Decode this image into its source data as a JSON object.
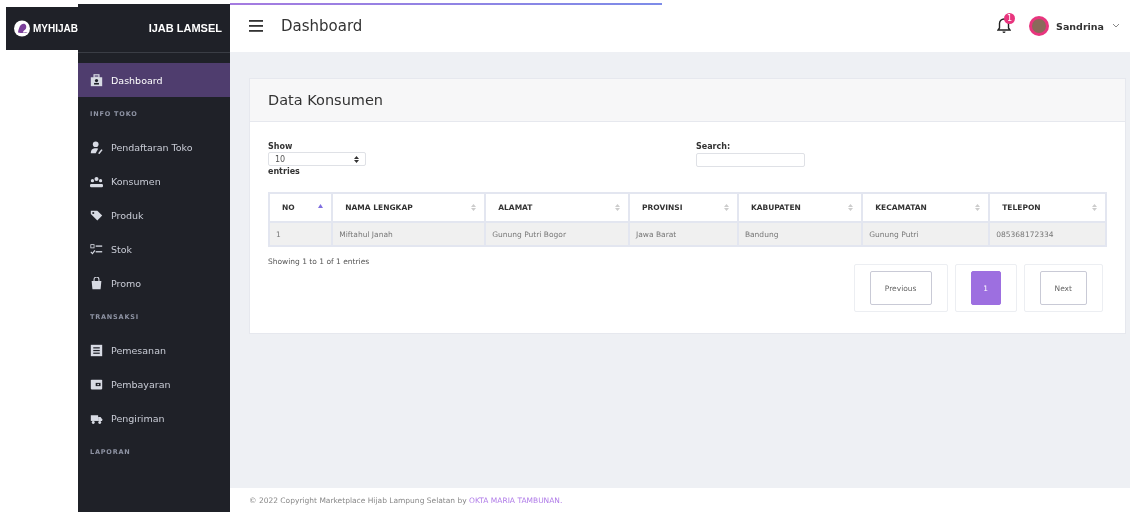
{
  "brand": {
    "logo_text": "MYHIJAB",
    "header_text": "IJAB LAMSEL"
  },
  "sidebar": {
    "items": [
      {
        "kind": "item",
        "label": "Dashboard",
        "selected": true
      },
      {
        "kind": "header",
        "label": "INFO TOKO"
      },
      {
        "kind": "item",
        "label": "Pendaftaran Toko",
        "selected": false
      },
      {
        "kind": "item",
        "label": "Konsumen",
        "selected": false
      },
      {
        "kind": "item",
        "label": "Produk",
        "selected": false
      },
      {
        "kind": "item",
        "label": "Stok",
        "selected": false
      },
      {
        "kind": "item",
        "label": "Promo",
        "selected": false
      },
      {
        "kind": "header",
        "label": "TRANSAKSI"
      },
      {
        "kind": "item",
        "label": "Pemesanan",
        "selected": false
      },
      {
        "kind": "item",
        "label": "Pembayaran",
        "selected": false
      },
      {
        "kind": "item",
        "label": "Pengiriman",
        "selected": false
      },
      {
        "kind": "header",
        "label": "LAPORAN"
      }
    ]
  },
  "topbar": {
    "loading": {
      "level": 0.48
    },
    "title": "Dashboard",
    "notification_count": "1",
    "user": "Sandrina"
  },
  "card": {
    "title": "Data Konsumen",
    "length_label": "Show",
    "length_value": "10",
    "length_suffix": "entries",
    "search_label": "Search:",
    "table": {
      "columns": [
        {
          "label": "NO",
          "sorted": true
        },
        {
          "label": "NAMA LENGKAP",
          "sorted": false
        },
        {
          "label": "ALAMAT",
          "sorted": false
        },
        {
          "label": "PROVINSI",
          "sorted": false
        },
        {
          "label": "KABUPATEN",
          "sorted": false
        },
        {
          "label": "KECAMATAN",
          "sorted": false
        },
        {
          "label": "TELEPON",
          "sorted": false
        }
      ],
      "rows": [
        [
          "1",
          "Miftahul Janah",
          "Gunung Putri Bogor",
          "Jawa Barat",
          "Bandung",
          "Gunung Putri",
          "085368172334"
        ]
      ]
    },
    "info": "Showing 1 to 1 of 1 entries",
    "pagination": [
      {
        "label": "Previous",
        "selected": false
      },
      {
        "label": "1",
        "selected": true
      },
      {
        "label": "Next",
        "selected": false
      }
    ]
  },
  "footer": {
    "text": "© 2022 Copyright Marketplace Hijab Lampung Selatan by ",
    "link": "OKTA MARIA TAMBUNAN."
  }
}
